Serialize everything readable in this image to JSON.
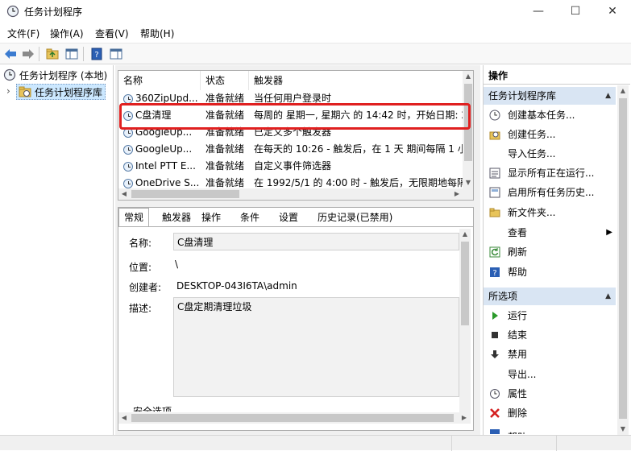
{
  "window": {
    "title": "任务计划程序",
    "minimize": "—",
    "maximize": "☐",
    "close": "✕"
  },
  "menu": [
    "文件(F)",
    "操作(A)",
    "查看(V)",
    "帮助(H)"
  ],
  "tree": {
    "root": "任务计划程序 (本地)",
    "child": "任务计划程序库",
    "expander": "›"
  },
  "tasklist": {
    "columns": [
      "名称",
      "状态",
      "触发器"
    ],
    "rows": [
      {
        "name": "360ZipUpd...",
        "status": "准备就绪",
        "trigger": "当任何用户登录时"
      },
      {
        "name": "C盘清理",
        "status": "准备就绪",
        "trigger": "每周的 星期一, 星期六 的 14:42 时，开始日期: 2"
      },
      {
        "name": "GoogleUp...",
        "status": "准备就绪",
        "trigger": "已定义多个触发器"
      },
      {
        "name": "GoogleUp...",
        "status": "准备就绪",
        "trigger": "在每天的 10:26 - 触发后，在 1 天 期间每隔 1 小"
      },
      {
        "name": "Intel PTT E...",
        "status": "准备就绪",
        "trigger": "自定义事件筛选器"
      },
      {
        "name": "OneDrive S...",
        "status": "准备就绪",
        "trigger": "在 1992/5/1 的 4:00 时 - 触发后，无限期地每隔"
      }
    ]
  },
  "details": {
    "tabs": [
      "常规",
      "触发器",
      "操作",
      "条件",
      "设置",
      "历史记录(已禁用)"
    ],
    "name_label": "名称:",
    "name_value": "C盘清理",
    "location_label": "位置:",
    "location_value": "\\",
    "author_label": "创建者:",
    "author_value": "DESKTOP-043I6TA\\admin",
    "desc_label": "描述:",
    "desc_value": "C盘定期清理垃圾",
    "security_label": "安全选项"
  },
  "actions": {
    "title": "操作",
    "section1": "任务计划程序库",
    "items1": [
      {
        "label": "创建基本任务...",
        "icon": "basic-task-icon"
      },
      {
        "label": "创建任务...",
        "icon": "create-task-icon"
      },
      {
        "label": "导入任务...",
        "icon": "import-icon"
      },
      {
        "label": "显示所有正在运行...",
        "icon": "running-tasks-icon"
      },
      {
        "label": "启用所有任务历史...",
        "icon": "history-icon"
      },
      {
        "label": "新文件夹...",
        "icon": "folder-icon"
      },
      {
        "label": "查看",
        "icon": "view-icon"
      },
      {
        "label": "刷新",
        "icon": "refresh-icon"
      },
      {
        "label": "帮助",
        "icon": "help-icon"
      }
    ],
    "section2": "所选项",
    "items2": [
      {
        "label": "运行",
        "icon": "run-icon"
      },
      {
        "label": "结束",
        "icon": "end-icon"
      },
      {
        "label": "禁用",
        "icon": "disable-icon"
      },
      {
        "label": "导出...",
        "icon": "export-icon"
      },
      {
        "label": "属性",
        "icon": "properties-icon"
      },
      {
        "label": "删除",
        "icon": "delete-icon"
      },
      {
        "label": "帮助",
        "icon": "help-icon"
      }
    ]
  },
  "colors": {
    "highlight": "#e02020",
    "section_header": "#d9e5f3",
    "selected": "#cce8ff"
  }
}
